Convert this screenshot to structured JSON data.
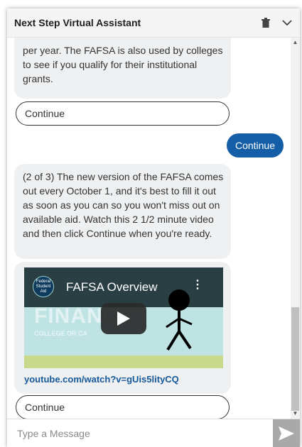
{
  "header": {
    "title": "Next Step Virtual Assistant",
    "trash_icon": "trash-icon",
    "collapse_icon": "chevron-down-icon"
  },
  "messages": {
    "bubble1": "per year. The FAFSA is also used by colleges to see if you qualify for their institutional grants.",
    "continue1": "Continue",
    "user_reply": "Continue",
    "bubble2": "(2 of 3) The new version of the FAFSA comes out every October 1, and it's best to fill it out as soon as you can so you won't miss out on available aid. Watch this 2 1/2 minute video and then click Continue when you're ready.",
    "video": {
      "logo_text": "Federal Student Aid",
      "title": "FAFSA Overview",
      "background_title": "FINANCI",
      "background_subtitle": "COLLEGE OR CA",
      "play_icon": "play-icon"
    },
    "video_link": "youtube.com/watch?v=gUis5lityCQ",
    "continue2": "Continue"
  },
  "composer": {
    "placeholder": "Type a Message",
    "send_icon": "send-icon"
  },
  "colors": {
    "user_bubble": "#145ea8",
    "link": "#15589a",
    "bot_bubble": "#eef0f2"
  }
}
